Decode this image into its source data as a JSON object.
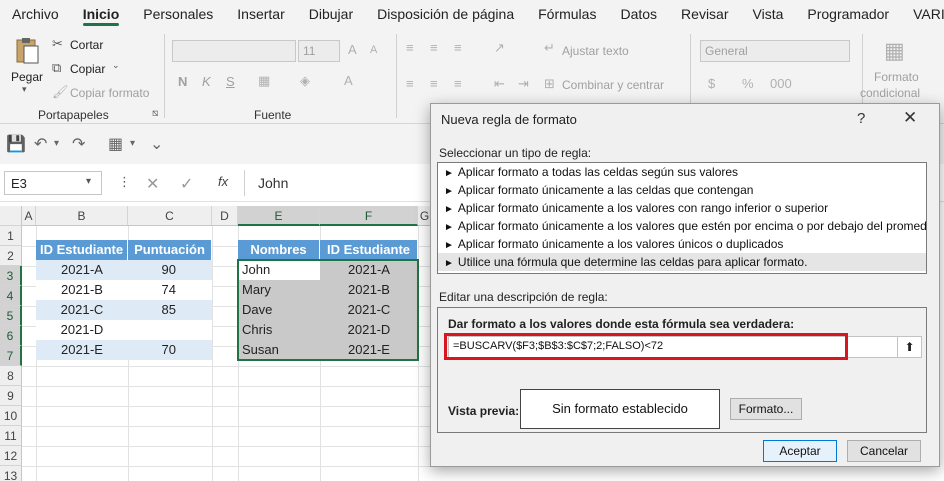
{
  "menubar": {
    "items": [
      "Archivo",
      "Inicio",
      "Personales",
      "Insertar",
      "Dibujar",
      "Disposición de página",
      "Fórmulas",
      "Datos",
      "Revisar",
      "Vista",
      "Programador",
      "VARI"
    ]
  },
  "ribbon": {
    "paste_label": "Pegar",
    "cut_label": "Cortar",
    "copy_label": "Copiar",
    "format_painter_label": "Copiar formato",
    "clipboard_group": "Portapapeles",
    "font_group": "Fuente",
    "font_size": "11",
    "bold": "N",
    "italic": "K",
    "underline": "S",
    "wrap_text": "Ajustar texto",
    "merge_center": "Combinar y centrar",
    "number_format": "General",
    "cond_format_line1": "Formato",
    "cond_format_line2": "condicional"
  },
  "formula_bar": {
    "name_box": "E3",
    "fx": "fx",
    "value": "John"
  },
  "sheet": {
    "columns": [
      "A",
      "B",
      "C",
      "D",
      "E",
      "F",
      "G"
    ],
    "rows": [
      "1",
      "2",
      "3",
      "4",
      "5",
      "6",
      "7",
      "8",
      "9",
      "10",
      "11",
      "12",
      "13"
    ],
    "table1": {
      "headers": [
        "ID Estudiante",
        "Puntuación"
      ],
      "rows": [
        [
          "2021-A",
          "90"
        ],
        [
          "2021-B",
          "74"
        ],
        [
          "2021-C",
          "85"
        ],
        [
          "2021-D",
          ""
        ],
        [
          "2021-E",
          "70"
        ]
      ]
    },
    "table2": {
      "headers": [
        "Nombres",
        "ID Estudiante"
      ],
      "rows": [
        [
          "John",
          "2021-A"
        ],
        [
          "Mary",
          "2021-B"
        ],
        [
          "Dave",
          "2021-C"
        ],
        [
          "Chris",
          "2021-D"
        ],
        [
          "Susan",
          "2021-E"
        ]
      ]
    }
  },
  "dialog": {
    "title": "Nueva regla de formato",
    "help": "?",
    "close": "✕",
    "select_type_label": "Seleccionar un tipo de regla:",
    "rule_types": [
      "Aplicar formato a todas las celdas según sus valores",
      "Aplicar formato únicamente a las celdas que contengan",
      "Aplicar formato únicamente a los valores con rango inferior o superior",
      "Aplicar formato únicamente a los valores que estén por encima o por debajo del promedio",
      "Aplicar formato únicamente a los valores únicos o duplicados",
      "Utilice una fórmula que determine las celdas para aplicar formato."
    ],
    "edit_desc_label": "Editar una descripción de regla:",
    "formula_title": "Dar formato a los valores donde esta fórmula sea verdadera:",
    "formula": "=BUSCARV($F3;$B$3:$C$7;2;FALSO)<72",
    "preview_label": "Vista previa:",
    "preview_text": "Sin formato establecido",
    "format_button": "Formato...",
    "ok_button": "Aceptar",
    "cancel_button": "Cancelar"
  }
}
